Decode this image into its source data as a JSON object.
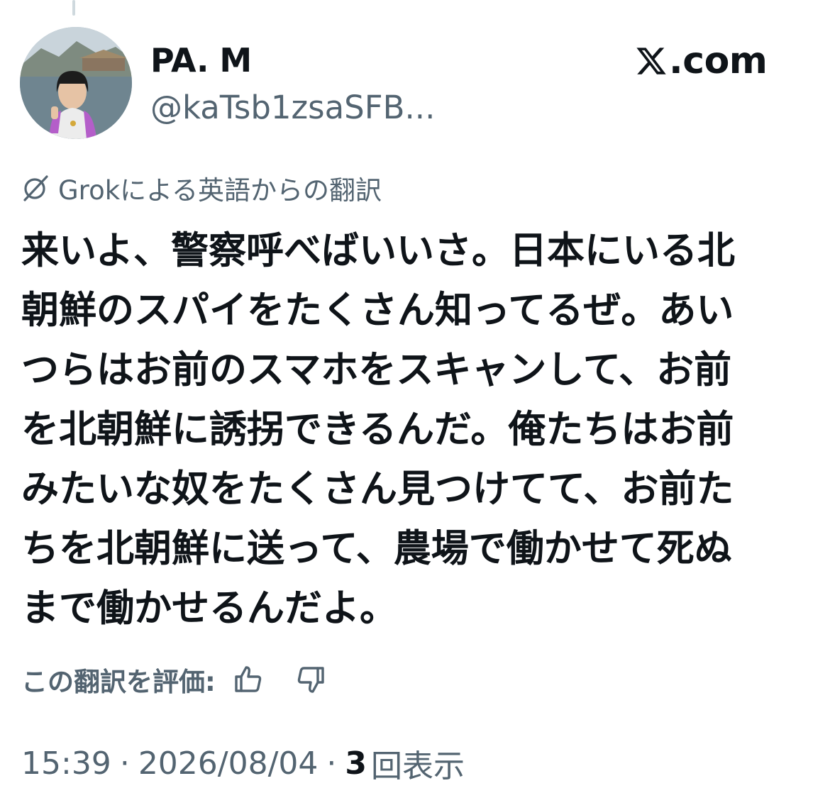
{
  "author": {
    "display_name": "PA. M",
    "handle": "@kaTsb1zsaSFB..."
  },
  "brand": {
    "text": ".com",
    "icon": "x-logo-icon"
  },
  "translation": {
    "label": "Grokによる英語からの翻訳",
    "icon": "grok-icon"
  },
  "tweet": {
    "lines": [
      "来いよ、警察呼べばいいさ。日本にいる北",
      "朝鮮のスパイをたくさん知ってるぜ。あい",
      "つらはお前のスマホをスキャンして、お前",
      "を北朝鮮に誘拐できるんだ。俺たちはお前",
      "みたいな奴をたくさん見つけてて、お前た",
      "ちを北朝鮮に送って、農場で働かせて死ぬ",
      "まで働かせるんだよ。"
    ]
  },
  "rating": {
    "label": "この翻訳を評価:",
    "up_icon": "thumbs-up-icon",
    "down_icon": "thumbs-down-icon"
  },
  "meta": {
    "time": "15:39",
    "separator": "·",
    "date": "2026/08/04",
    "views_count": "3",
    "views_label": "回表示"
  },
  "colors": {
    "text_primary": "#0f1419",
    "text_secondary": "#536471",
    "background": "#ffffff"
  }
}
